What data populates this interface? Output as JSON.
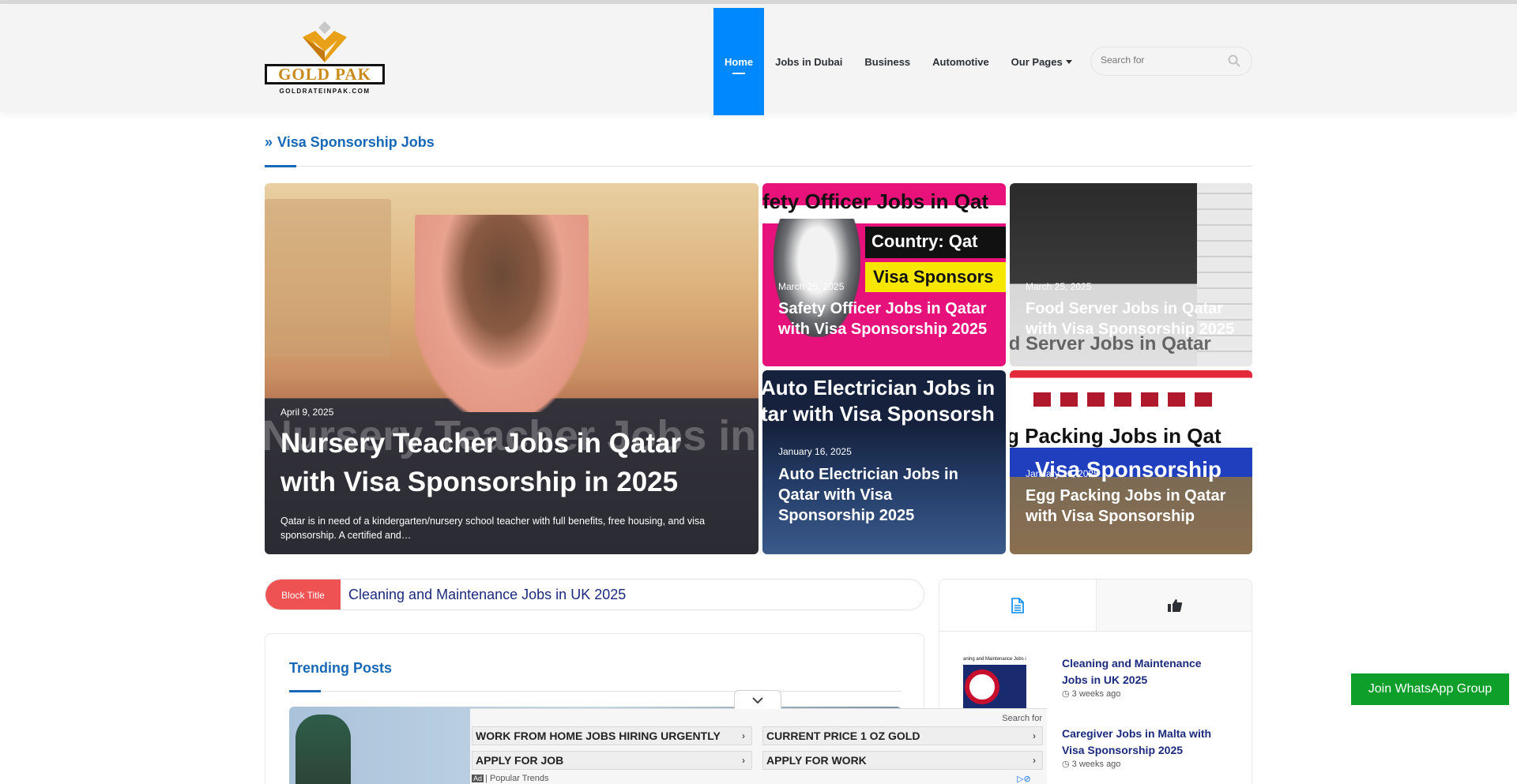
{
  "header": {
    "logo_text": "GOLD PAK",
    "logo_sub": "GOLDRATEINPAK.COM",
    "nav": [
      {
        "label": "Home",
        "active": true
      },
      {
        "label": "Jobs in Dubai"
      },
      {
        "label": "Business"
      },
      {
        "label": "Automotive"
      },
      {
        "label": "Our Pages"
      }
    ],
    "search_placeholder": "Search for"
  },
  "section": {
    "title": "Visa Sponsorship Jobs"
  },
  "featured": [
    {
      "date": "April 9, 2025",
      "title": "Nursery Teacher Jobs in Qatar with Visa Sponsorship in 2025",
      "excerpt": "Qatar is in need of a kindergarten/nursery school teacher with full benefits, free housing, and visa sponsorship. A certified and…",
      "bg_text": "Nursery Teacher Jobs in Qatar with Visa Sponsorshi"
    },
    {
      "date": "March 25, 2025",
      "title": "Safety Officer Jobs in Qatar with Visa Sponsorship 2025",
      "bg_banner": "fety Officer Jobs in Qat",
      "bg_country": "Country: Qat",
      "bg_visa": "Visa Sponsors"
    },
    {
      "date": "March 25, 2025",
      "title": "Food Server Jobs in Qatar with Visa Sponsorship 2025",
      "bg_text": "od Server Jobs in Qatar"
    },
    {
      "date": "January 16, 2025",
      "title": "Auto Electrician Jobs in Qatar with Visa Sponsorship 2025",
      "bg_line1": "Auto Electrician Jobs in",
      "bg_line2": "tar with Visa Sponsorsh"
    },
    {
      "date": "January 16, 2025",
      "title": "Egg Packing Jobs in Qatar with Visa Sponsorship",
      "bg_text": "g Packing Jobs in Qat",
      "bg_visa": "Visa Sponsorship"
    }
  ],
  "ticker": {
    "label": "Block Title",
    "text": "Cleaning and Maintenance Jobs in UK 2025"
  },
  "trending": {
    "title": "Trending Posts"
  },
  "sidebar": {
    "tabs": [
      {
        "icon": "document-icon"
      },
      {
        "icon": "thumbs-up-icon"
      }
    ],
    "items": [
      {
        "title": "Cleaning and Maintenance Jobs in UK 2025",
        "time": "3 weeks ago",
        "thumb_text": "aning and Maintenance Jobs in U"
      },
      {
        "title": "Caregiver Jobs in Malta with Visa Sponsorship 2025",
        "time": "3 weeks ago"
      }
    ]
  },
  "whatsapp": {
    "label": "Join WhatsApp Group"
  },
  "ad": {
    "search_for": "Search for",
    "buttons": [
      "WORK FROM HOME JOBS HIRING URGENTLY",
      "APPLY FOR JOB",
      "CURRENT PRICE 1 OZ GOLD",
      "APPLY FOR WORK"
    ],
    "badge": "Ad",
    "footer": "Popular Trends"
  },
  "colors": {
    "accent": "#0088ff",
    "title_blue": "#1769b7",
    "link_navy": "#1b2a7c",
    "ticker_red": "#ee5253",
    "whatsapp_green": "#0d9f2a",
    "logo_gold": "#c98b1d"
  }
}
